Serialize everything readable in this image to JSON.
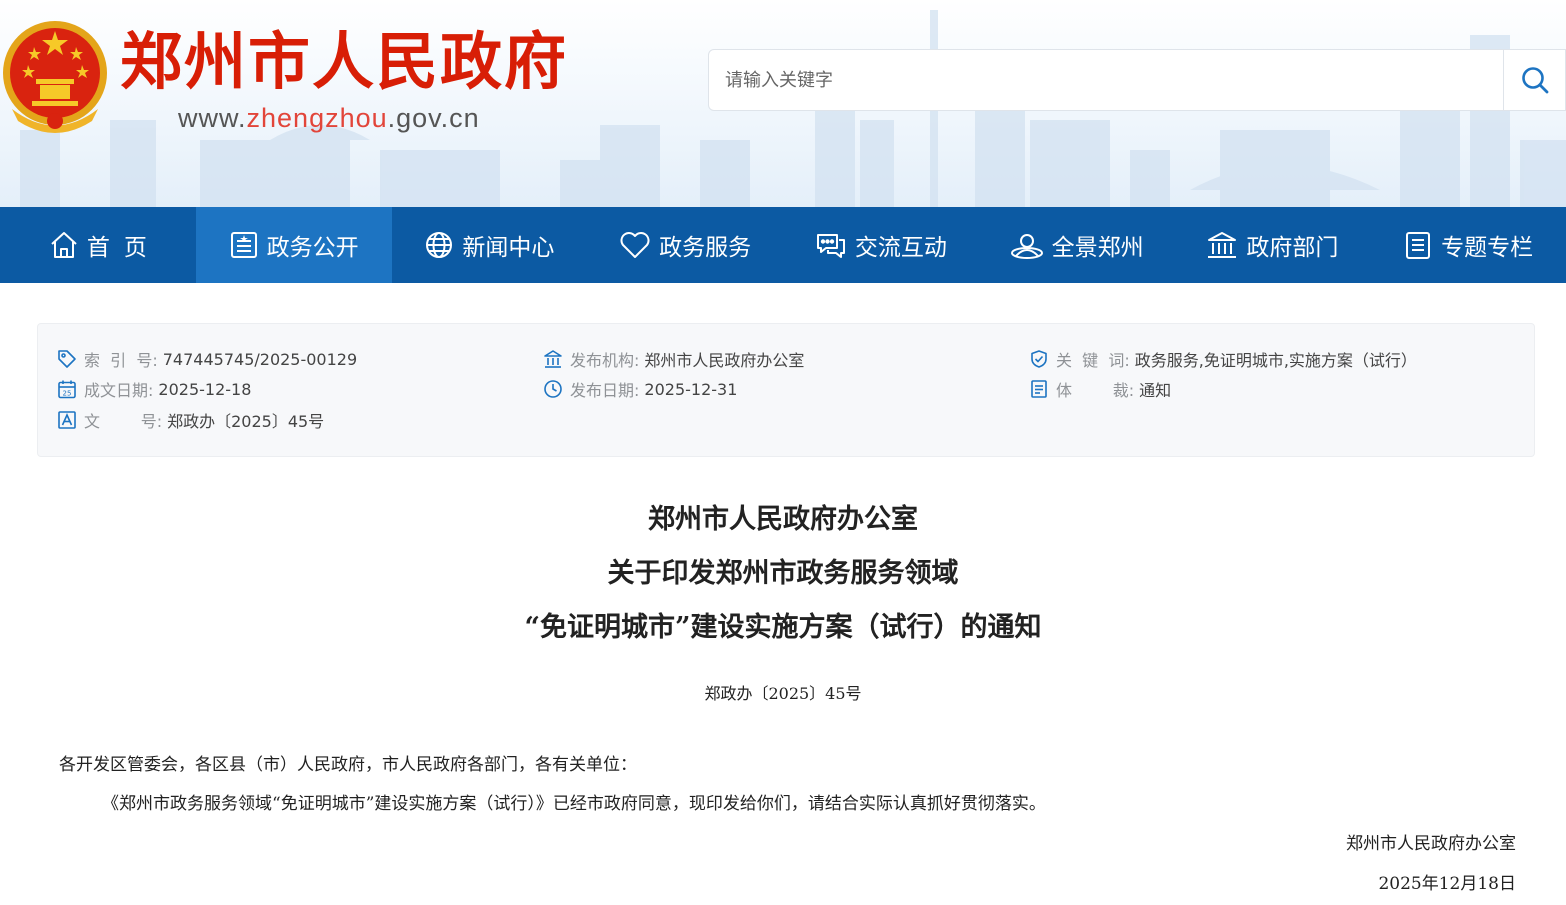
{
  "header": {
    "site_title": "郑州市人民政府",
    "site_url_prefix": "www.",
    "site_url_highlight": "zhengzhou",
    "site_url_suffix": ".gov.cn",
    "emblem_icon": "national-emblem-icon",
    "search": {
      "placeholder": "请输入关键字",
      "value": "",
      "button_icon": "search-icon"
    }
  },
  "nav": {
    "active_index": 1,
    "items": [
      {
        "label": "首页",
        "icon": "home-icon"
      },
      {
        "label": "政务公开",
        "icon": "document-list-icon"
      },
      {
        "label": "新闻中心",
        "icon": "globe-icon"
      },
      {
        "label": "政务服务",
        "icon": "heart-icon"
      },
      {
        "label": "交流互动",
        "icon": "chat-icon"
      },
      {
        "label": "全景郑州",
        "icon": "user-circle-icon"
      },
      {
        "label": "政府部门",
        "icon": "government-building-icon"
      },
      {
        "label": "专题专栏",
        "icon": "notes-icon"
      }
    ]
  },
  "meta": {
    "index_no": {
      "label": "索  引  号:",
      "value": "747445745/2025-00129",
      "icon": "tag-icon"
    },
    "issuer": {
      "label": "发布机构:",
      "value": "郑州市人民政府办公室",
      "icon": "institution-icon"
    },
    "keywords": {
      "label": "关  键  词:",
      "value": "政务服务,免证明城市,实施方案（试行）",
      "icon": "shield-check-icon"
    },
    "created_date": {
      "label": "成文日期:",
      "value": "2025-12-18",
      "icon": "calendar-icon"
    },
    "publish_date": {
      "label": "发布日期:",
      "value": "2025-12-31",
      "icon": "clock-icon"
    },
    "doc_type": {
      "label": "体        裁:",
      "value": "通知",
      "icon": "doc-type-icon"
    },
    "doc_no": {
      "label": "文        号:",
      "value": "郑政办〔2025〕45号",
      "icon": "document-number-icon"
    }
  },
  "document": {
    "title_lines": [
      "郑州市人民政府办公室",
      "关于印发郑州市政务服务领域",
      "“免证明城市”建设实施方案（试行）的通知"
    ],
    "number": "郑政办〔2025〕45号",
    "salutation": "各开发区管委会，各区县（市）人民政府，市人民政府各部门，各有关单位：",
    "body": "《郑州市政务服务领域“免证明城市”建设实施方案（试行）》已经市政府同意，现印发给你们，请结合实际认真抓好贯彻落实。",
    "signature": "郑州市人民政府办公室",
    "date": "2025年12月18日"
  },
  "colors": {
    "nav_bg": "#0c5aa3",
    "nav_active": "#1d74c2",
    "title_red": "#d81e06",
    "url_highlight": "#e2453a"
  }
}
